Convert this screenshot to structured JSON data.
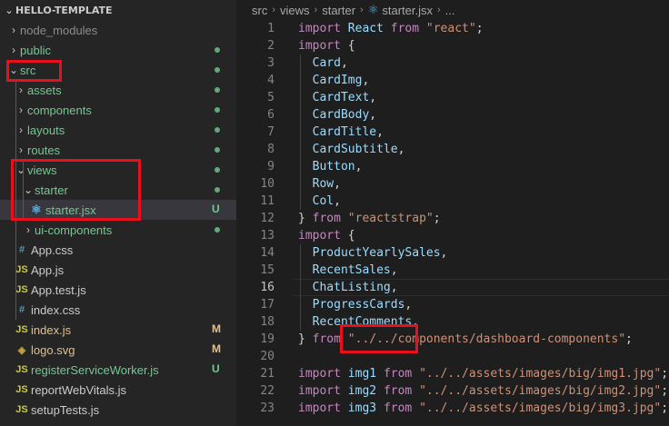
{
  "explorer": {
    "title": "HELLO-TEMPLATE",
    "items": [
      {
        "label": "node_modules",
        "tw": "›",
        "icon": "",
        "color": "#8c8c8c",
        "status": ""
      },
      {
        "label": "public",
        "tw": "›",
        "icon": "",
        "color": "#73c991",
        "status": "dot"
      },
      {
        "label": "src",
        "tw": "⌄",
        "icon": "",
        "color": "#73c991",
        "status": "dot"
      },
      {
        "label": "assets",
        "tw": "›",
        "icon": "",
        "color": "#73c991",
        "status": "dot"
      },
      {
        "label": "components",
        "tw": "›",
        "icon": "",
        "color": "#73c991",
        "status": "dot"
      },
      {
        "label": "layouts",
        "tw": "›",
        "icon": "",
        "color": "#73c991",
        "status": "dot"
      },
      {
        "label": "routes",
        "tw": "›",
        "icon": "",
        "color": "#73c991",
        "status": "dot"
      },
      {
        "label": "views",
        "tw": "⌄",
        "icon": "",
        "color": "#73c991",
        "status": "dot"
      },
      {
        "label": "starter",
        "tw": "⌄",
        "icon": "",
        "color": "#73c991",
        "status": "dot"
      },
      {
        "label": "starter.jsx",
        "tw": "",
        "icon": "⚛",
        "color": "#73c991",
        "status": "U"
      },
      {
        "label": "ui-components",
        "tw": "›",
        "icon": "",
        "color": "#73c991",
        "status": "dot"
      },
      {
        "label": "App.css",
        "tw": "",
        "icon": "#",
        "color": "#cccccc",
        "status": ""
      },
      {
        "label": "App.js",
        "tw": "",
        "icon": "JS",
        "color": "#cccccc",
        "status": ""
      },
      {
        "label": "App.test.js",
        "tw": "",
        "icon": "JS",
        "color": "#cccccc",
        "status": ""
      },
      {
        "label": "index.css",
        "tw": "",
        "icon": "#",
        "color": "#cccccc",
        "status": ""
      },
      {
        "label": "index.js",
        "tw": "",
        "icon": "JS",
        "color": "#e2c08d",
        "status": "M"
      },
      {
        "label": "logo.svg",
        "tw": "",
        "icon": "◈",
        "color": "#e2c08d",
        "status": "M"
      },
      {
        "label": "registerServiceWorker.js",
        "tw": "",
        "icon": "JS",
        "color": "#73c991",
        "status": "U"
      },
      {
        "label": "reportWebVitals.js",
        "tw": "",
        "icon": "JS",
        "color": "#cccccc",
        "status": ""
      },
      {
        "label": "setupTests.js",
        "tw": "",
        "icon": "JS",
        "color": "#cccccc",
        "status": ""
      }
    ]
  },
  "breadcrumb": {
    "parts": [
      "src",
      "views",
      "starter",
      "starter.jsx",
      "..."
    ]
  },
  "editor": {
    "active_line": 16,
    "lines": [
      {
        "n": "1",
        "t": [
          [
            "kwc",
            "import"
          ],
          [
            "pn",
            " "
          ],
          [
            "id",
            "React"
          ],
          [
            "pn",
            " "
          ],
          [
            "kwc",
            "from"
          ],
          [
            "pn",
            " "
          ],
          [
            "str",
            "\"react\""
          ],
          [
            "pn",
            ";"
          ]
        ]
      },
      {
        "n": "2",
        "t": [
          [
            "kwc",
            "import"
          ],
          [
            "pn",
            " {"
          ]
        ]
      },
      {
        "n": "3",
        "t": [
          [
            "pn",
            "  "
          ],
          [
            "id",
            "Card"
          ],
          [
            "pn",
            ","
          ]
        ]
      },
      {
        "n": "4",
        "t": [
          [
            "pn",
            "  "
          ],
          [
            "id",
            "CardImg"
          ],
          [
            "pn",
            ","
          ]
        ]
      },
      {
        "n": "5",
        "t": [
          [
            "pn",
            "  "
          ],
          [
            "id",
            "CardText"
          ],
          [
            "pn",
            ","
          ]
        ]
      },
      {
        "n": "6",
        "t": [
          [
            "pn",
            "  "
          ],
          [
            "id",
            "CardBody"
          ],
          [
            "pn",
            ","
          ]
        ]
      },
      {
        "n": "7",
        "t": [
          [
            "pn",
            "  "
          ],
          [
            "id",
            "CardTitle"
          ],
          [
            "pn",
            ","
          ]
        ]
      },
      {
        "n": "8",
        "t": [
          [
            "pn",
            "  "
          ],
          [
            "id",
            "CardSubtitle"
          ],
          [
            "pn",
            ","
          ]
        ]
      },
      {
        "n": "9",
        "t": [
          [
            "pn",
            "  "
          ],
          [
            "id",
            "Button"
          ],
          [
            "pn",
            ","
          ]
        ]
      },
      {
        "n": "10",
        "t": [
          [
            "pn",
            "  "
          ],
          [
            "id",
            "Row"
          ],
          [
            "pn",
            ","
          ]
        ]
      },
      {
        "n": "11",
        "t": [
          [
            "pn",
            "  "
          ],
          [
            "id",
            "Col"
          ],
          [
            "pn",
            ","
          ]
        ]
      },
      {
        "n": "12",
        "t": [
          [
            "pn",
            "} "
          ],
          [
            "kwc",
            "from"
          ],
          [
            "pn",
            " "
          ],
          [
            "str",
            "\"reactstrap\""
          ],
          [
            "pn",
            ";"
          ]
        ]
      },
      {
        "n": "13",
        "t": [
          [
            "kwc",
            "import"
          ],
          [
            "pn",
            " {"
          ]
        ]
      },
      {
        "n": "14",
        "t": [
          [
            "pn",
            "  "
          ],
          [
            "id",
            "ProductYearlySales"
          ],
          [
            "pn",
            ","
          ]
        ]
      },
      {
        "n": "15",
        "t": [
          [
            "pn",
            "  "
          ],
          [
            "id",
            "RecentSales"
          ],
          [
            "pn",
            ","
          ]
        ]
      },
      {
        "n": "16",
        "t": [
          [
            "pn",
            "  "
          ],
          [
            "id",
            "ChatListing"
          ],
          [
            "pn",
            ","
          ]
        ]
      },
      {
        "n": "17",
        "t": [
          [
            "pn",
            "  "
          ],
          [
            "id",
            "ProgressCards"
          ],
          [
            "pn",
            ","
          ]
        ]
      },
      {
        "n": "18",
        "t": [
          [
            "pn",
            "  "
          ],
          [
            "id",
            "RecentComments"
          ],
          [
            "pn",
            ","
          ]
        ]
      },
      {
        "n": "19",
        "t": [
          [
            "pn",
            "} "
          ],
          [
            "kwc",
            "from"
          ],
          [
            "pn",
            " "
          ],
          [
            "str",
            "\"../../components/dashboard-components\""
          ],
          [
            "pn",
            ";"
          ]
        ]
      },
      {
        "n": "20",
        "t": []
      },
      {
        "n": "21",
        "t": [
          [
            "kwc",
            "import"
          ],
          [
            "pn",
            " "
          ],
          [
            "id",
            "img1"
          ],
          [
            "pn",
            " "
          ],
          [
            "kwc",
            "from"
          ],
          [
            "pn",
            " "
          ],
          [
            "str",
            "\"../../assets/images/big/img1.jpg\""
          ],
          [
            "pn",
            ";"
          ]
        ]
      },
      {
        "n": "22",
        "t": [
          [
            "kwc",
            "import"
          ],
          [
            "pn",
            " "
          ],
          [
            "id",
            "img2"
          ],
          [
            "pn",
            " "
          ],
          [
            "kwc",
            "from"
          ],
          [
            "pn",
            " "
          ],
          [
            "str",
            "\"../../assets/images/big/img2.jpg\""
          ],
          [
            "pn",
            ";"
          ]
        ]
      },
      {
        "n": "23",
        "t": [
          [
            "kwc",
            "import"
          ],
          [
            "pn",
            " "
          ],
          [
            "id",
            "img3"
          ],
          [
            "pn",
            " "
          ],
          [
            "kwc",
            "from"
          ],
          [
            "pn",
            " "
          ],
          [
            "str",
            "\"../../assets/images/big/img3.jpg\""
          ],
          [
            "pn",
            ";"
          ]
        ]
      }
    ]
  },
  "colors": {
    "highlight_box": "#e8101c",
    "git_untracked": "#73c991",
    "git_modified": "#e2c08d"
  }
}
